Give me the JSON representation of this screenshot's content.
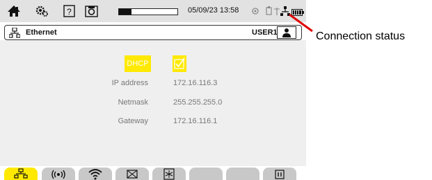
{
  "statusbar": {
    "icons": [
      "home-icon",
      "settings-gears-icon",
      "help-icon",
      "camera-icon",
      "progress-bar",
      "sync-icon",
      "usb-icon",
      "network-icon",
      "battery-icon"
    ],
    "datetime": "05/09/23 13:58"
  },
  "titlebar": {
    "icon": "ethernet-icon",
    "title": "Ethernet",
    "user": "USER1",
    "user_icon": "user-icon"
  },
  "form": {
    "dhcp_label": "DHCP",
    "dhcp_checked": true,
    "rows": [
      {
        "label": "IP address",
        "value": "172.16.116.3"
      },
      {
        "label": "Netmask",
        "value": "255.255.255.0"
      },
      {
        "label": "Gateway",
        "value": "172.16.116.1"
      }
    ]
  },
  "tabs": [
    {
      "icon": "ethernet-icon",
      "active": true
    },
    {
      "icon": "wireless-broadcast-icon",
      "active": false
    },
    {
      "icon": "wifi-icon",
      "active": false
    },
    {
      "icon": "mail-icon",
      "active": false
    },
    {
      "icon": "server-icon",
      "active": false
    },
    {
      "icon": "",
      "active": false
    },
    {
      "icon": "",
      "active": false
    },
    {
      "icon": "sd-card-icon",
      "active": false
    }
  ],
  "annotation": {
    "text": "Connection status"
  },
  "colors": {
    "highlight": "#ffe900",
    "statusbar": "#e2e2e2",
    "content_bg": "#efefef",
    "tab_bg": "#c8c8c8"
  }
}
